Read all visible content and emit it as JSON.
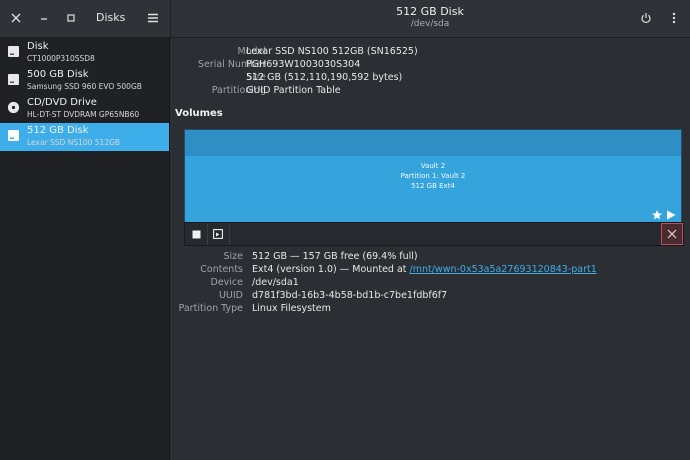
{
  "window": {
    "sidebar_title": "Disks",
    "title": "512 GB Disk",
    "subtitle": "/dev/sda"
  },
  "disks": [
    {
      "name": "Disk",
      "model": "CT1000P310SSD8",
      "icon": "drive-icon"
    },
    {
      "name": "500 GB Disk",
      "model": "Samsung SSD 960 EVO 500GB",
      "icon": "drive-icon"
    },
    {
      "name": "CD/DVD Drive",
      "model": "HL-DT-ST DVDRAM GP65NB60",
      "icon": "optical-disc-icon"
    },
    {
      "name": "512 GB Disk",
      "model": "Lexar SSD NS100 512GB",
      "icon": "drive-icon",
      "selected": true
    }
  ],
  "disk_info": {
    "model_label": "Model",
    "model": "Lexar SSD NS100 512GB (SN16525)",
    "serial_label": "Serial Number",
    "serial": "PGH693W1003030S304",
    "size_label": "Size",
    "size": "512 GB (512,110,190,592 bytes)",
    "partitioning_label": "Partitioning",
    "partitioning": "GUID Partition Table"
  },
  "volumes": {
    "title": "Volumes",
    "segment": {
      "line1": "Vault 2",
      "line2": "Partition 1: Vault 2",
      "line3": "512 GB Ext4"
    }
  },
  "partition_info": {
    "size_label": "Size",
    "size": "512 GB — 157 GB free (69.4% full)",
    "contents_label": "Contents",
    "contents_prefix": "Ext4 (version 1.0) — Mounted at ",
    "contents_link": "/mnt/wwn-0x53a5a27693120843-part1",
    "device_label": "Device",
    "device": "/dev/sda1",
    "uuid_label": "UUID",
    "uuid": "d781f3bd-16b3-4b58-bd1b-c7be1fdbf6f7",
    "type_label": "Partition Type",
    "type": "Linux Filesystem"
  },
  "colors": {
    "accent": "#3daee9",
    "background": "#2b2e33",
    "sidebar": "#1f2125",
    "danger": "#b9515c"
  }
}
